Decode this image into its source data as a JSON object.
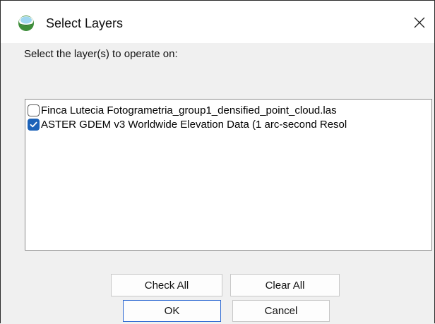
{
  "window": {
    "title": "Select Layers",
    "app_icon": "app-logo-icon",
    "close_icon": "close-icon"
  },
  "prompt": "Select the layer(s) to operate on:",
  "layers": [
    {
      "label": "Finca Lutecia Fotogrametria_group1_densified_point_cloud.las",
      "checked": false
    },
    {
      "label": "ASTER GDEM v3 Worldwide Elevation Data (1 arc-second Resol",
      "checked": true
    }
  ],
  "buttons": {
    "check_all": "Check All",
    "clear_all": "Clear All",
    "ok": "OK",
    "cancel": "Cancel"
  },
  "colors": {
    "accent": "#1c62b8",
    "default_button_border": "#2f6ad2"
  }
}
